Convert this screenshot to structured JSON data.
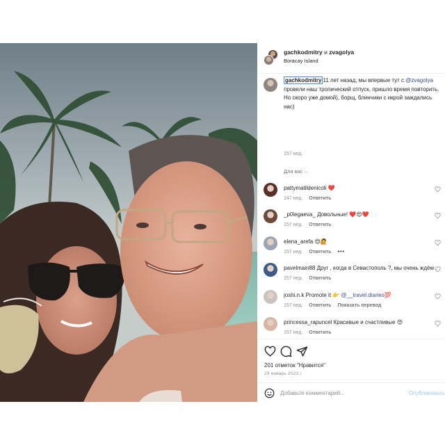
{
  "post": {
    "author_primary": "gachkodmitry",
    "joiner": "и",
    "author_secondary": "zvagolya",
    "location": "Boracay Island"
  },
  "caption": {
    "username": "gachkodmitry",
    "text_before": "11 лет назад, мы впервые тут с ",
    "mention": "@zvagolya",
    "text_after": " провели наш тропический отпуск, пришло время повторить. Но скоро уже домой), борщ, блинчики с икрой заждались нас)",
    "time": "157 нед."
  },
  "for_you": {
    "label": "Для вас",
    "icon": "chevron-down-icon"
  },
  "comments": [
    {
      "user": "pattymatildenicoli",
      "text": "❤️",
      "time": "147 нед.",
      "reply": "Ответить",
      "extra": "",
      "avatar_color": "#5a2f28"
    },
    {
      "user": "_p0legaeva_",
      "text": "Довольные! ❤️😍❤️",
      "time": "157 нед.",
      "reply": "Ответить",
      "extra": "",
      "avatar_color": "#6e4a3a"
    },
    {
      "user": "elena_arefa",
      "text": "😍🙋",
      "time": "157 нед.",
      "reply": "Ответить",
      "extra": "•••",
      "avatar_color": "#9aa7b3"
    },
    {
      "user": "pavelmain88",
      "text": "Друг , когда в Севастополь ?, мы очень ждём .",
      "time": "157 нед.",
      "reply": "Ответить",
      "extra": "",
      "avatar_color": "#3b5b8a"
    },
    {
      "user": "joshi.n.k",
      "text": "Promote it 👉 ",
      "mention": "@__travel.diaries",
      "text2": "💯",
      "time": "157 нед.",
      "reply": "Ответить",
      "extra": "Показать перевод",
      "avatar_color": "#c9c2bd"
    },
    {
      "user": "princessa_rapuncel",
      "text": "Красивые и счастливые 😍",
      "time": "157 нед.",
      "reply": "Ответить",
      "extra": "",
      "avatar_color": "#d8b6a5"
    }
  ],
  "actions": {
    "like_icon": "heart-icon",
    "comment_icon": "comment-icon",
    "share_icon": "share-icon",
    "likes_text": "201 отметок \"Нравится\"",
    "date": "29 январь 2023 г."
  },
  "add_comment": {
    "emoji_icon": "emoji-icon",
    "placeholder": "Добавьте комментарий...",
    "publish_label": "Опубликовать"
  }
}
